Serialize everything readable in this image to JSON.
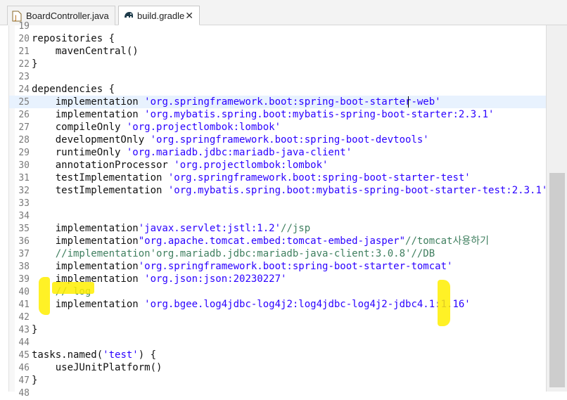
{
  "tabs": [
    {
      "label": "BoardController.java",
      "icon": "java-file-icon",
      "active": false
    },
    {
      "label": "build.gradle",
      "icon": "gradle-elephant-icon",
      "active": true,
      "close": "✕"
    }
  ],
  "editor": {
    "lines": [
      {
        "num": "19",
        "segments": []
      },
      {
        "num": "20",
        "segments": [
          {
            "t": "repositories {",
            "c": "plain"
          }
        ]
      },
      {
        "num": "21",
        "segments": [
          {
            "t": "    mavenCentral()",
            "c": "plain"
          }
        ]
      },
      {
        "num": "22",
        "segments": [
          {
            "t": "}",
            "c": "plain"
          }
        ]
      },
      {
        "num": "23",
        "segments": []
      },
      {
        "num": "24",
        "segments": [
          {
            "t": "dependencies {",
            "c": "plain"
          }
        ]
      },
      {
        "num": "25",
        "current": true,
        "segments": [
          {
            "t": "    implementation ",
            "c": "plain"
          },
          {
            "t": "'org.springframework.boot:spring-boot-starter-web'",
            "c": "str"
          }
        ]
      },
      {
        "num": "26",
        "segments": [
          {
            "t": "    implementation ",
            "c": "plain"
          },
          {
            "t": "'org.mybatis.spring.boot:mybatis-spring-boot-starter:2.3.1'",
            "c": "str"
          }
        ]
      },
      {
        "num": "27",
        "segments": [
          {
            "t": "    compileOnly ",
            "c": "plain"
          },
          {
            "t": "'org.projectlombok:lombok'",
            "c": "str"
          }
        ]
      },
      {
        "num": "28",
        "segments": [
          {
            "t": "    developmentOnly ",
            "c": "plain"
          },
          {
            "t": "'org.springframework.boot:spring-boot-devtools'",
            "c": "str"
          }
        ]
      },
      {
        "num": "29",
        "segments": [
          {
            "t": "    runtimeOnly ",
            "c": "plain"
          },
          {
            "t": "'org.mariadb.jdbc:mariadb-java-client'",
            "c": "str"
          }
        ]
      },
      {
        "num": "30",
        "segments": [
          {
            "t": "    annotationProcessor ",
            "c": "plain"
          },
          {
            "t": "'org.projectlombok:lombok'",
            "c": "str"
          }
        ]
      },
      {
        "num": "31",
        "segments": [
          {
            "t": "    testImplementation ",
            "c": "plain"
          },
          {
            "t": "'org.springframework.boot:spring-boot-starter-test'",
            "c": "str"
          }
        ]
      },
      {
        "num": "32",
        "segments": [
          {
            "t": "    testImplementation ",
            "c": "plain"
          },
          {
            "t": "'org.mybatis.spring.boot:mybatis-spring-boot-starter-test:2.3.1'",
            "c": "str"
          }
        ]
      },
      {
        "num": "33",
        "segments": []
      },
      {
        "num": "34",
        "segments": []
      },
      {
        "num": "35",
        "segments": [
          {
            "t": "    implementation",
            "c": "plain"
          },
          {
            "t": "'javax.servlet:jstl:1.2'",
            "c": "str"
          },
          {
            "t": "//jsp",
            "c": "cmt"
          }
        ]
      },
      {
        "num": "36",
        "segments": [
          {
            "t": "    implementation",
            "c": "plain"
          },
          {
            "t": "\"org.apache.tomcat.embed:tomcat-embed-jasper\"",
            "c": "str"
          },
          {
            "t": "//tomcat사용하기",
            "c": "cmt"
          }
        ]
      },
      {
        "num": "37",
        "segments": [
          {
            "t": "    //implementation'org.mariadb.jdbc:mariadb-java-client:3.0.8'//DB",
            "c": "cmt"
          }
        ]
      },
      {
        "num": "38",
        "segments": [
          {
            "t": "    implementation",
            "c": "plain"
          },
          {
            "t": "'org.springframework.boot:spring-boot-starter-tomcat'",
            "c": "str"
          }
        ]
      },
      {
        "num": "39",
        "segments": [
          {
            "t": "    implementation ",
            "c": "plain"
          },
          {
            "t": "'org.json:json:20230227'",
            "c": "str"
          }
        ]
      },
      {
        "num": "40",
        "segments": [
          {
            "t": "    // log",
            "c": "cmt"
          }
        ]
      },
      {
        "num": "41",
        "segments": [
          {
            "t": "    implementation ",
            "c": "plain"
          },
          {
            "t": "'org.bgee.log4jdbc-log4j2:log4jdbc-log4j2-jdbc4.1:1.16'",
            "c": "str"
          }
        ]
      },
      {
        "num": "42",
        "segments": []
      },
      {
        "num": "43",
        "segments": [
          {
            "t": "}",
            "c": "plain"
          }
        ]
      },
      {
        "num": "44",
        "segments": []
      },
      {
        "num": "45",
        "segments": [
          {
            "t": "tasks.named(",
            "c": "plain"
          },
          {
            "t": "'test'",
            "c": "str"
          },
          {
            "t": ") {",
            "c": "plain"
          }
        ]
      },
      {
        "num": "46",
        "segments": [
          {
            "t": "    useJUnitPlatform()",
            "c": "plain"
          }
        ]
      },
      {
        "num": "47",
        "segments": [
          {
            "t": "}",
            "c": "plain"
          }
        ]
      },
      {
        "num": "48",
        "segments": []
      }
    ]
  },
  "colors": {
    "string": "#2a00ff",
    "comment": "#3f7f5f",
    "current_line": "#e8f2fe",
    "highlighter": "#ffee00"
  }
}
